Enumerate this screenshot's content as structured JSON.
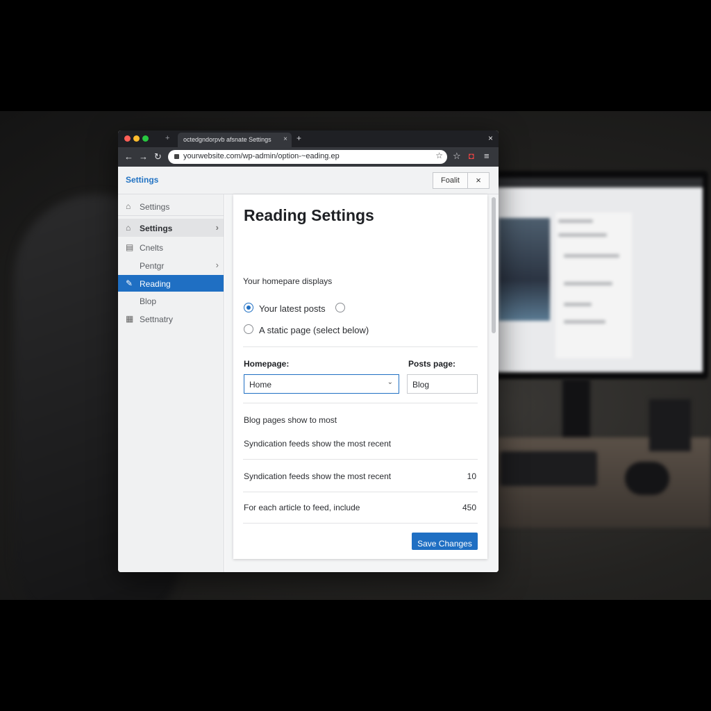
{
  "browser": {
    "tab_title": "octedgndorpvb afsnate Settings",
    "tab_close": "×",
    "new_tab": "+",
    "url": "yourwebsite.com/wp-admin/option-~eading.ep",
    "window_close": "×"
  },
  "header": {
    "title": "Settings",
    "button_label": "Foalit",
    "close_label": "×"
  },
  "sidebar": {
    "items": [
      {
        "label": "Settings",
        "icon": "home-icon"
      },
      {
        "label": "Settings",
        "icon": "home-icon"
      },
      {
        "label": "Cnelts",
        "icon": "media-icon"
      },
      {
        "label": "Pentgr"
      },
      {
        "label": "Reading",
        "icon": "reading-icon"
      },
      {
        "label": "Blop"
      },
      {
        "label": "Settnatry",
        "icon": "tools-icon"
      }
    ]
  },
  "main": {
    "title": "Reading Settings",
    "homepage_displays_label": "Your homepare displays",
    "option_latest": "Your latest posts",
    "option_static": "A static page (select below)",
    "homepage_label": "Homepage:",
    "homepage_value": "Home",
    "posts_page_label": "Posts page:",
    "posts_page_value": "Blog",
    "blog_pages_label": "Blog pages show to most",
    "syndication_label_1": "Syndication feeds show the most recent",
    "syndication_label_2": "Syndication feeds show the most recent",
    "syndication_value": "10",
    "feed_article_label": "For each article to feed, include",
    "feed_article_value": "450",
    "save_label": "Save Changes"
  },
  "colors": {
    "accent": "#1f6fc3",
    "traffic_red": "#ff5f57",
    "traffic_yellow": "#febc2e",
    "traffic_green": "#28c840"
  }
}
